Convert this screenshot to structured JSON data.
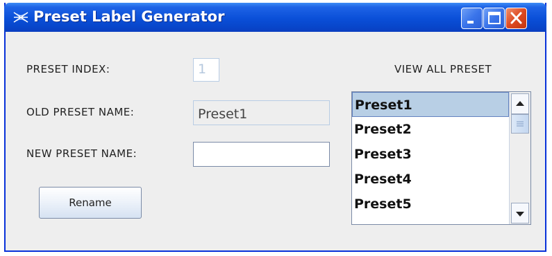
{
  "window": {
    "title": "Preset Label Generator",
    "controls": {
      "minimize": "minimize-icon",
      "maximize": "maximize-icon",
      "close": "close-icon"
    }
  },
  "form": {
    "preset_index_label": "PRESET INDEX:",
    "preset_index_value": "1",
    "old_name_label": "OLD PRESET NAME:",
    "old_name_value": "Preset1",
    "new_name_label": "NEW PRESET NAME:",
    "new_name_value": "",
    "rename_button": "Rename"
  },
  "preset_list": {
    "heading": "VIEW ALL PRESET",
    "items": [
      "Preset1",
      "Preset2",
      "Preset3",
      "Preset4",
      "Preset5"
    ],
    "selected_index": 0
  },
  "colors": {
    "titlebar": "#0a4fd8",
    "close_button": "#de4a22",
    "selection": "#b8cfe5"
  }
}
